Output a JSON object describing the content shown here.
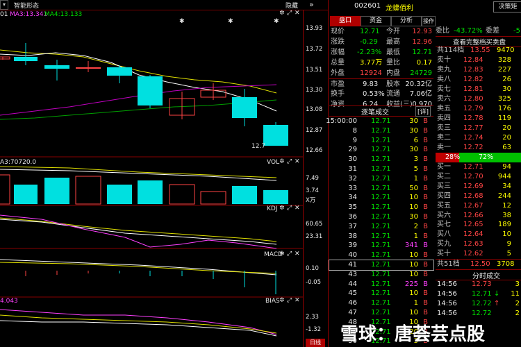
{
  "topbar": {
    "menu_label": "智能形态",
    "hide_label": "隐藏",
    "ma_left": "01",
    "ma3": "MA3:13.341",
    "ma4": "MA4:13.133"
  },
  "price_axis": [
    "13.93",
    "13.72",
    "13.51",
    "13.30",
    "13.08",
    "12.87",
    "12.66"
  ],
  "last_price_label": "12.7",
  "volume_panel": {
    "label": "VOL",
    "header": "A3:70720.0",
    "ticks": [
      "7.49",
      "3.74"
    ],
    "unit": "X万"
  },
  "kdj_panel": {
    "label": "KDJ",
    "ticks": [
      "60.65",
      "23.31"
    ]
  },
  "macd_panel": {
    "label": "MACD",
    "ticks": [
      "0.10",
      "-0.05"
    ]
  },
  "bias_panel": {
    "label": "BIAS",
    "header": "4.043",
    "ticks": [
      "2.33",
      "-1.32"
    ]
  },
  "bottom_tag": "日线",
  "right": {
    "stock_code": "002601",
    "stock_name": "龙蟒佰利",
    "decision_btn": "决策矩",
    "tabs": [
      "盘口",
      "资金",
      "分析",
      "操作"
    ],
    "quote_rows": [
      {
        "l1": "现价",
        "v1": "12.71",
        "l2": "今开",
        "v2": "12.93"
      },
      {
        "l1": "涨跌",
        "v1": "-0.29",
        "l2": "最高",
        "v2": "12.96"
      },
      {
        "l1": "涨幅",
        "v1": "-2.23%",
        "l2": "最低",
        "v2": "12.71"
      },
      {
        "l1": "总量",
        "v1": "3.77万",
        "l2": "量比",
        "v2": "0.17"
      },
      {
        "l1": "外盘",
        "v1": "12924",
        "l2": "内盘",
        "v2": "24729"
      },
      {
        "l1": "市盈",
        "v1": "9.83",
        "l2": "股本",
        "v2": "20.32亿"
      },
      {
        "l1": "换手",
        "v1": "0.53%",
        "l2": "流通",
        "v2": "7.06亿"
      },
      {
        "l1": "净资",
        "v1": "6.24",
        "l2": "收益(三)",
        "v2": "0.970"
      }
    ],
    "ticks_header": "逐笔成交",
    "ticks_detail": "[详]",
    "ticks": [
      {
        "t": "15:00:00",
        "p": "12.71",
        "v": "30",
        "d": "B"
      },
      {
        "t": "8",
        "p": "12.71",
        "v": "30",
        "d": "B"
      },
      {
        "t": "9",
        "p": "12.71",
        "v": "6",
        "d": "B"
      },
      {
        "t": "29",
        "p": "12.71",
        "v": "30",
        "d": "B"
      },
      {
        "t": "30",
        "p": "12.71",
        "v": "3",
        "d": "B"
      },
      {
        "t": "31",
        "p": "12.71",
        "v": "5",
        "d": "B"
      },
      {
        "t": "32",
        "p": "12.71",
        "v": "1",
        "d": "B"
      },
      {
        "t": "33",
        "p": "12.71",
        "v": "50",
        "d": "B"
      },
      {
        "t": "34",
        "p": "12.71",
        "v": "10",
        "d": "B"
      },
      {
        "t": "35",
        "p": "12.71",
        "v": "10",
        "d": "B"
      },
      {
        "t": "36",
        "p": "12.71",
        "v": "30",
        "d": "B"
      },
      {
        "t": "37",
        "p": "12.71",
        "v": "2",
        "d": "B"
      },
      {
        "t": "38",
        "p": "12.71",
        "v": "1",
        "d": "B"
      },
      {
        "t": "39",
        "p": "12.71",
        "v": "341",
        "d": "B"
      },
      {
        "t": "40",
        "p": "12.71",
        "v": "10",
        "d": "B"
      },
      {
        "t": "41",
        "p": "12.71",
        "v": "10",
        "d": "B"
      },
      {
        "t": "43",
        "p": "12.71",
        "v": "10",
        "d": "B"
      },
      {
        "t": "44",
        "p": "12.71",
        "v": "225",
        "d": "B"
      },
      {
        "t": "45",
        "p": "12.71",
        "v": "10",
        "d": "B"
      },
      {
        "t": "46",
        "p": "12.71",
        "v": "1",
        "d": "B"
      },
      {
        "t": "47",
        "p": "12.71",
        "v": "10",
        "d": "B"
      },
      {
        "t": "48",
        "p": "12.71",
        "v": "10",
        "d": "B"
      },
      {
        "t": "49",
        "p": "12.71",
        "v": "20",
        "d": "B"
      },
      {
        "t": "50",
        "p": "12.71",
        "v": "3",
        "d": "B"
      }
    ],
    "weibi": {
      "l": "委比",
      "v": "-43.72%",
      "l2": "委差",
      "v2": "-5"
    },
    "full_book_label": "查看完整档买卖盘",
    "sell_total": {
      "l": "共114档",
      "p": "13.55",
      "v": "9470"
    },
    "sells": [
      {
        "l": "卖十",
        "p": "12.84",
        "v": "328"
      },
      {
        "l": "卖九",
        "p": "12.83",
        "v": "227"
      },
      {
        "l": "卖八",
        "p": "12.82",
        "v": "26"
      },
      {
        "l": "卖七",
        "p": "12.81",
        "v": "30"
      },
      {
        "l": "卖六",
        "p": "12.80",
        "v": "325"
      },
      {
        "l": "卖五",
        "p": "12.79",
        "v": "176"
      },
      {
        "l": "卖四",
        "p": "12.78",
        "v": "119"
      },
      {
        "l": "卖三",
        "p": "12.77",
        "v": "20"
      },
      {
        "l": "卖二",
        "p": "12.74",
        "v": "20"
      },
      {
        "l": "卖一",
        "p": "12.72",
        "v": "63"
      }
    ],
    "ratio_left": "28%",
    "ratio_left_value": 0.28,
    "ratio_right": "72%",
    "buys": [
      {
        "l": "买一",
        "p": "12.71",
        "v": "94"
      },
      {
        "l": "买二",
        "p": "12.70",
        "v": "944"
      },
      {
        "l": "买三",
        "p": "12.69",
        "v": "34"
      },
      {
        "l": "买四",
        "p": "12.68",
        "v": "244"
      },
      {
        "l": "买五",
        "p": "12.67",
        "v": "12"
      },
      {
        "l": "买六",
        "p": "12.66",
        "v": "38"
      },
      {
        "l": "买七",
        "p": "12.65",
        "v": "189"
      },
      {
        "l": "买八",
        "p": "12.64",
        "v": "10"
      },
      {
        "l": "买九",
        "p": "12.63",
        "v": "9"
      },
      {
        "l": "买十",
        "p": "12.62",
        "v": "5"
      }
    ],
    "buy_total": {
      "l": "共51档",
      "p": "12.50",
      "v": "3708"
    },
    "fenshi_label": "分时成交",
    "fenshi": [
      {
        "t": "14:56",
        "p": "12.73",
        "v": "3"
      },
      {
        "t": "14:56",
        "p": "12.71",
        "a": "↓",
        "v": "11"
      },
      {
        "t": "14:56",
        "p": "12.72",
        "a": "↑",
        "v": "2"
      },
      {
        "t": "14:56",
        "p": "12.72",
        "v": "2"
      }
    ]
  },
  "watermark": "雪球：唐荟芸点股",
  "colors": {
    "up": "#ff4444",
    "down": "#00e0e0",
    "grid": "#800000",
    "accent": "#b00000"
  }
}
